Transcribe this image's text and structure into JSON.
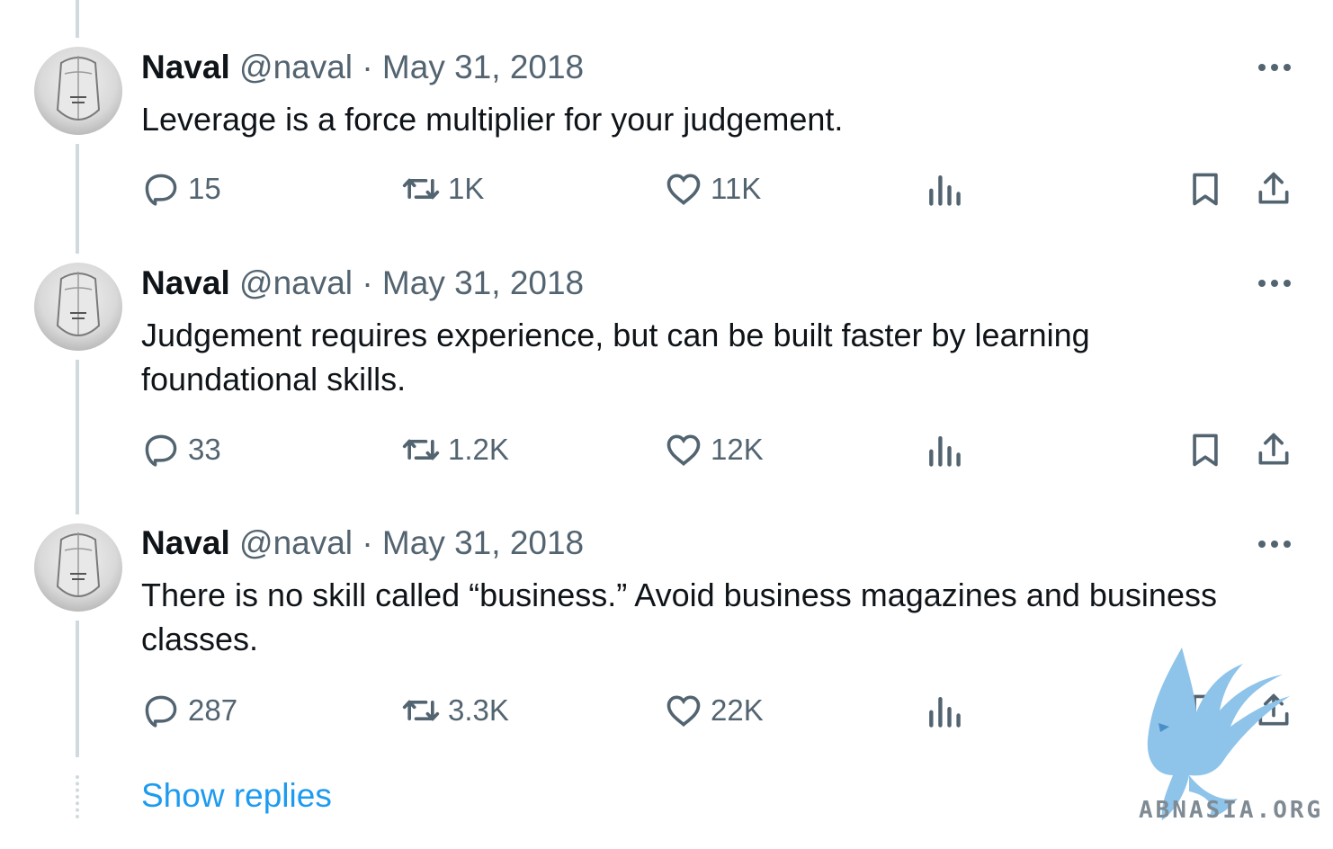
{
  "tweets": [
    {
      "name": "Naval",
      "handle": "@naval",
      "separator": "·",
      "date": "May 31, 2018",
      "text": "Leverage is a force multiplier for your judgement.",
      "replies": "15",
      "reposts": "1K",
      "likes": "11K"
    },
    {
      "name": "Naval",
      "handle": "@naval",
      "separator": "·",
      "date": "May 31, 2018",
      "text": "Judgement requires experience, but can be built faster by learning foundational skills.",
      "replies": "33",
      "reposts": "1.2K",
      "likes": "12K"
    },
    {
      "name": "Naval",
      "handle": "@naval",
      "separator": "·",
      "date": "May 31, 2018",
      "text": "There is no skill called “business.” Avoid business magazines and business classes.",
      "replies": "287",
      "reposts": "3.3K",
      "likes": "22K"
    }
  ],
  "show_replies": "Show replies",
  "watermark": "ABNASIA.ORG",
  "icons": [
    "reply-icon",
    "repost-icon",
    "like-icon",
    "views-icon",
    "bookmark-icon",
    "share-icon",
    "more-icon"
  ],
  "colors": {
    "text": "#0f1419",
    "secondary": "#536471",
    "link": "#1d9bf0",
    "thread_line": "#cfd9de"
  }
}
